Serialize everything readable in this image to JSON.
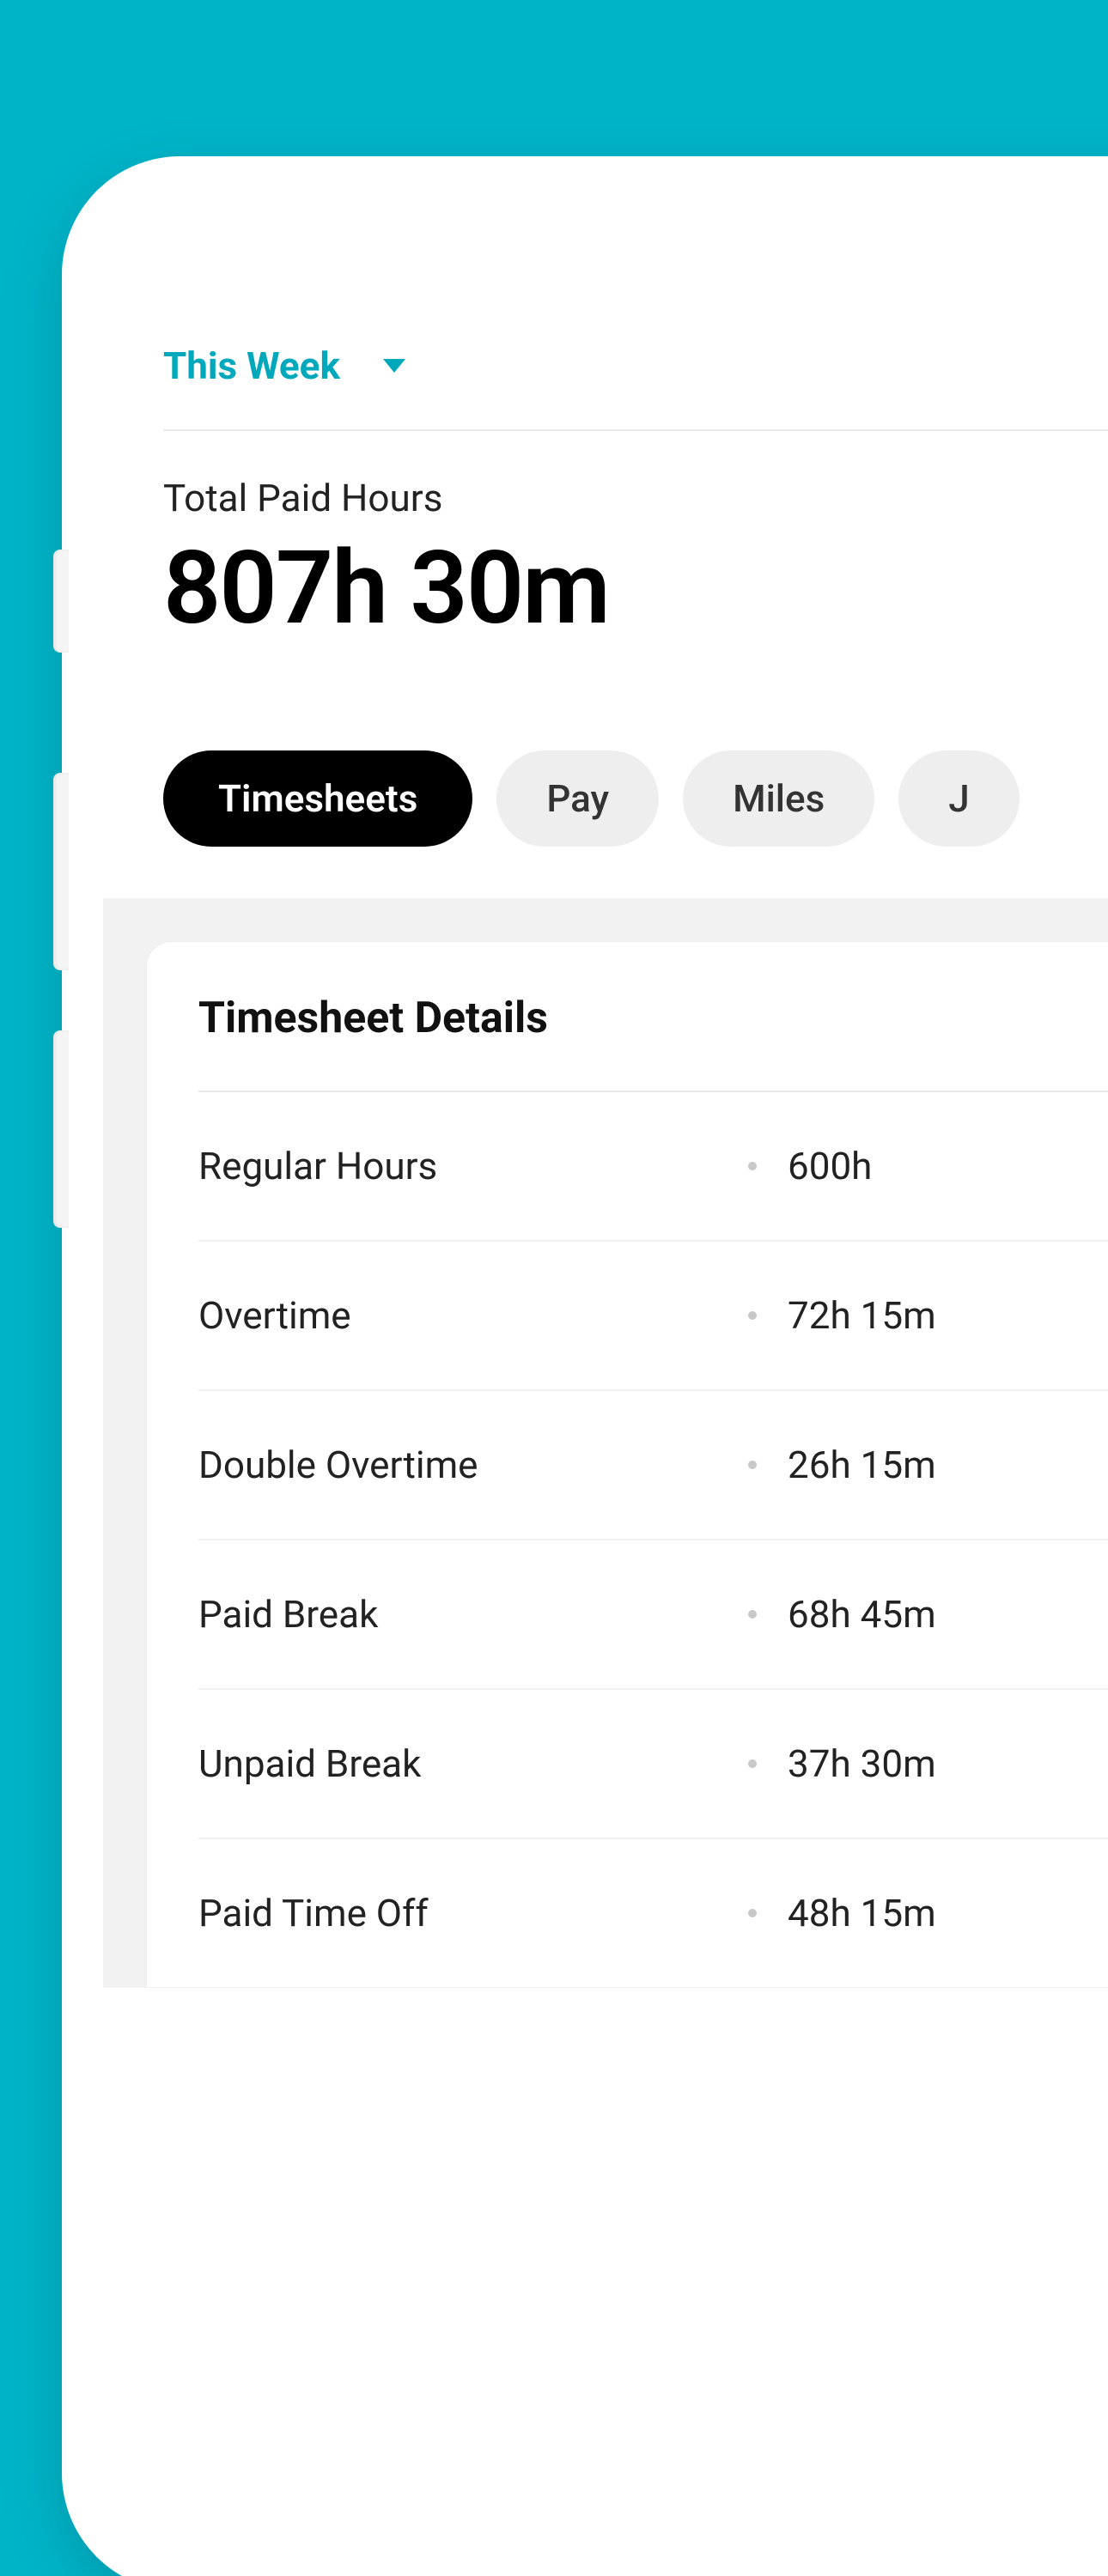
{
  "period": {
    "label": "This Week"
  },
  "summary": {
    "totalLabel": "Total Paid Hours",
    "totalValue": "807h  30m"
  },
  "tabs": [
    {
      "label": "Timesheets",
      "active": true
    },
    {
      "label": "Pay",
      "active": false
    },
    {
      "label": "Miles",
      "active": false
    },
    {
      "label": "J",
      "active": false
    }
  ],
  "details": {
    "title": "Timesheet Details",
    "rows": [
      {
        "label": "Regular Hours",
        "value": "600h"
      },
      {
        "label": "Overtime",
        "value": "72h 15m"
      },
      {
        "label": "Double Overtime",
        "value": "26h 15m"
      },
      {
        "label": "Paid Break",
        "value": "68h 45m"
      },
      {
        "label": "Unpaid Break",
        "value": "37h 30m"
      },
      {
        "label": "Paid Time Off",
        "value": "48h 15m"
      }
    ]
  },
  "colors": {
    "accent": "#00A8BC",
    "background": "#00B4C8"
  }
}
